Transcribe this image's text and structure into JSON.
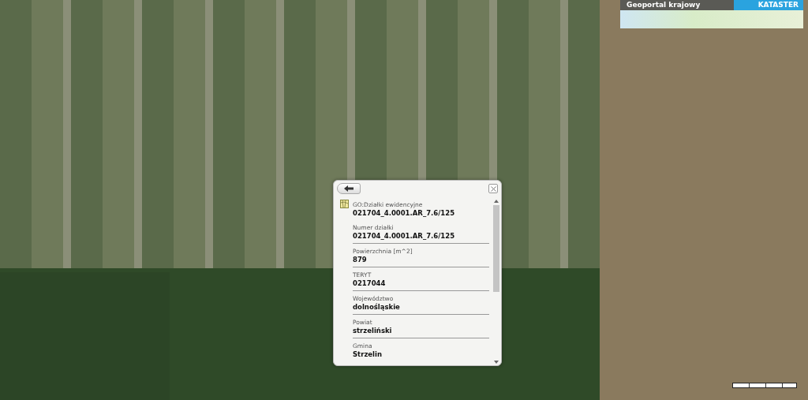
{
  "banner": {
    "title": "Geoportal krajowy",
    "badge": "KATASTER"
  },
  "popup": {
    "layer": "GO:Działki ewidencyjne",
    "feature_id": "021704_4.0001.AR_7.6/125",
    "fields": [
      {
        "label": "Numer działki",
        "value": "021704_4.0001.AR_7.6/125"
      },
      {
        "label": "Powierzchnia [m^2]",
        "value": "879"
      },
      {
        "label": "TERYT",
        "value": "0217044"
      },
      {
        "label": "Województwo",
        "value": "dolnośląskie"
      },
      {
        "label": "Powiat",
        "value": "strzeliński"
      },
      {
        "label": "Gmina",
        "value": "Strzelin"
      }
    ]
  }
}
